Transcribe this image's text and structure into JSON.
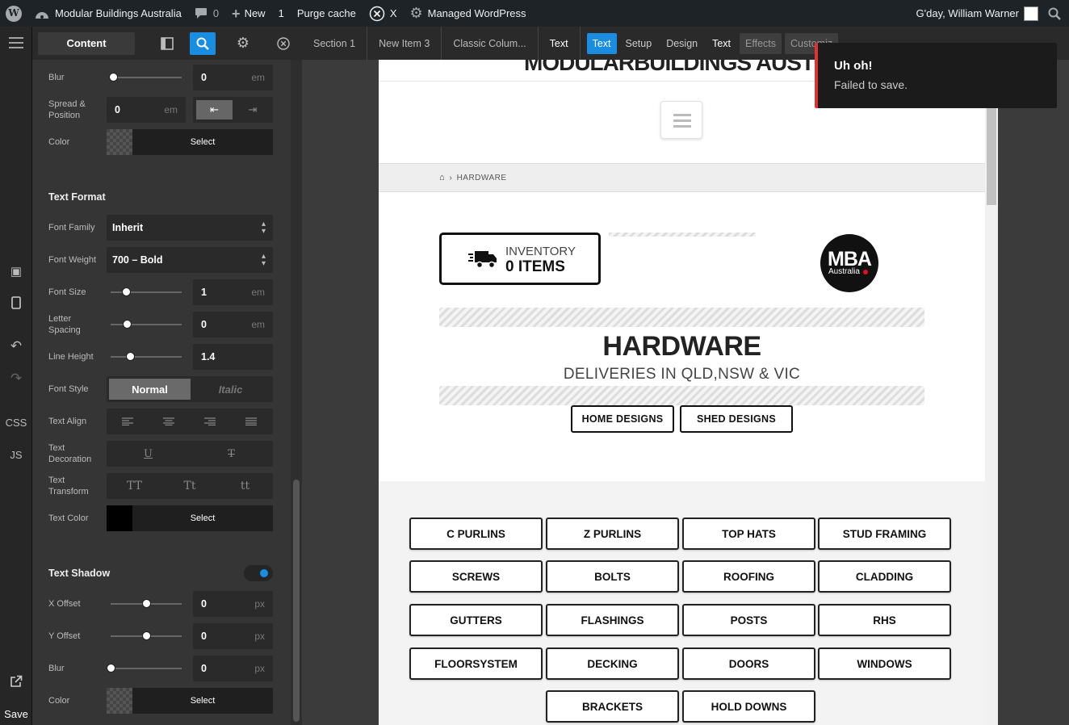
{
  "adminbar": {
    "site_name": "Modular Buildings Australia",
    "comments_count": "0",
    "new_label": "New",
    "updates_count": "1",
    "purge_cache": "Purge cache",
    "x_label": "X",
    "managed_wp": "Managed WordPress",
    "greeting": "G'day, William Warner"
  },
  "rail": {
    "css_label": "CSS",
    "js_label": "JS",
    "save_label": "Save"
  },
  "sidebar": {
    "content_tab": "Content",
    "box_shadow": {
      "blur_label": "Blur",
      "blur_value": "0",
      "blur_unit": "em",
      "spread_label": "Spread & Position",
      "spread_value": "0",
      "spread_unit": "em",
      "color_label": "Color",
      "color_select": "Select"
    },
    "text_format": {
      "title": "Text Format",
      "font_family_label": "Font Family",
      "font_family_value": "Inherit",
      "font_weight_label": "Font Weight",
      "font_weight_value": "700 – Bold",
      "font_size_label": "Font Size",
      "font_size_value": "1",
      "font_size_unit": "em",
      "letter_spacing_label": "Letter Spacing",
      "letter_spacing_value": "0",
      "letter_spacing_unit": "em",
      "line_height_label": "Line Height",
      "line_height_value": "1.4",
      "font_style_label": "Font Style",
      "font_style_normal": "Normal",
      "font_style_italic": "Italic",
      "text_align_label": "Text Align",
      "text_decoration_label": "Text Decoration",
      "decoration_underline": "U",
      "decoration_strike": "T",
      "text_transform_label": "Text Transform",
      "transform_upper": "TT",
      "transform_cap": "Tt",
      "transform_lower": "tt",
      "text_color_label": "Text Color",
      "text_color_select": "Select"
    },
    "text_shadow": {
      "title": "Text Shadow",
      "x_offset_label": "X Offset",
      "x_offset_value": "0",
      "x_offset_unit": "px",
      "y_offset_label": "Y Offset",
      "y_offset_value": "0",
      "y_offset_unit": "px",
      "blur_label": "Blur",
      "blur_value": "0",
      "blur_unit": "px",
      "color_label": "Color",
      "color_select": "Select"
    }
  },
  "toolbar": {
    "crumbs": [
      "Section 1",
      "New Item 3",
      "Classic Colum...",
      "Text"
    ],
    "text_tab": "Text",
    "setup": "Setup",
    "design": "Design",
    "text_label": "Text",
    "effects": "Effects",
    "customize": "Customiz"
  },
  "preview": {
    "cut_logo": "MODULARBUILDINGS AUSTRALIA",
    "breadcrumb": "HARDWARE",
    "inventory_line1": "INVENTORY",
    "inventory_line2": "0 ITEMS",
    "mba_big": "MBA",
    "mba_small": "Australia",
    "heading": "HARDWARE",
    "subheading": "DELIVERIES IN QLD,NSW & VIC",
    "btn_home": "HOME DESIGNS",
    "btn_shed": "SHED DESIGNS",
    "categories": [
      "C PURLINS",
      "Z PURLINS",
      "TOP HATS",
      "STUD FRAMING",
      "SCREWS",
      "BOLTS",
      "ROOFING",
      "CLADDING",
      "GUTTERS",
      "FLASHINGS",
      "POSTS",
      "RHS",
      "FLOORSYSTEM",
      "DECKING",
      "DOORS",
      "WINDOWS",
      "BRACKETS",
      "HOLD DOWNS"
    ]
  },
  "toast": {
    "title": "Uh oh!",
    "message": "Failed to save."
  },
  "colors": {
    "accent": "#1a8de0",
    "error": "#dd3333",
    "panel": "#353535",
    "adminbar": "#1d2327"
  },
  "controls": {
    "box_blur_level": 0.03,
    "font_size_level": 0.22,
    "letter_spacing_level": 0.23,
    "line_height_level": 0.27,
    "x_offset_level": 0.5,
    "y_offset_level": 0.5,
    "shadow_blur_level": 0.0,
    "text_shadow_enabled": true
  }
}
